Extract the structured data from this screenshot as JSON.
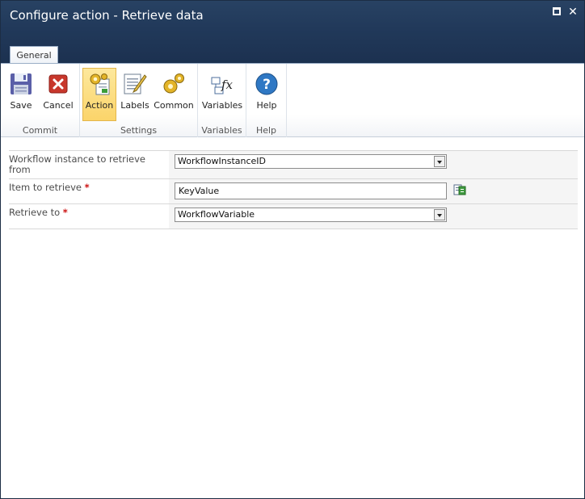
{
  "window": {
    "title": "Configure action - Retrieve data"
  },
  "tabs": [
    {
      "label": "General"
    }
  ],
  "ribbon": {
    "groups": [
      {
        "label": "Commit",
        "buttons": [
          {
            "label": "Save",
            "icon": "floppy-disk-icon"
          },
          {
            "label": "Cancel",
            "icon": "cancel-x-icon"
          }
        ]
      },
      {
        "label": "Settings",
        "buttons": [
          {
            "label": "Action",
            "icon": "gear-document-icon",
            "active": true
          },
          {
            "label": "Labels",
            "icon": "labels-pen-icon"
          },
          {
            "label": "Common",
            "icon": "gears-icon"
          }
        ]
      },
      {
        "label": "Variables",
        "buttons": [
          {
            "label": "Variables",
            "icon": "function-fx-icon"
          }
        ]
      },
      {
        "label": "Help",
        "buttons": [
          {
            "label": "Help",
            "icon": "question-icon"
          }
        ]
      }
    ]
  },
  "form": {
    "workflow_instance": {
      "label": "Workflow instance to retrieve from",
      "value": "WorkflowInstanceID"
    },
    "item_to_retrieve": {
      "label": "Item to retrieve",
      "required_mark": "*",
      "value": "KeyValue"
    },
    "retrieve_to": {
      "label": "Retrieve to",
      "required_mark": "*",
      "value": "WorkflowVariable"
    }
  },
  "colors": {
    "titlebar": "#21395a",
    "active_button": "#fbd46a",
    "required": "#cc1111"
  }
}
